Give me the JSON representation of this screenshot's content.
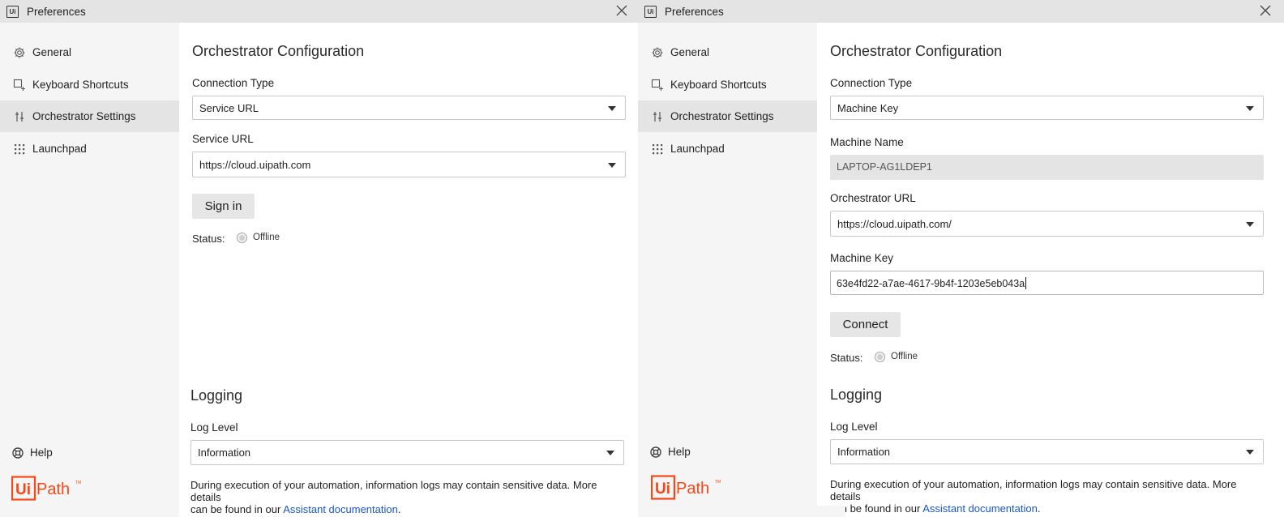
{
  "left": {
    "window_title": "Preferences",
    "sidebar": {
      "items": [
        {
          "label": "General",
          "icon": "gear-icon"
        },
        {
          "label": "Keyboard Shortcuts",
          "icon": "keyboard-shortcut-icon"
        },
        {
          "label": "Orchestrator Settings",
          "icon": "sliders-icon",
          "active": true
        },
        {
          "label": "Launchpad",
          "icon": "grid-dots-icon"
        }
      ],
      "help_label": "Help",
      "logo_text": "UiPath"
    },
    "orchestrator": {
      "heading": "Orchestrator Configuration",
      "connection_type_label": "Connection Type",
      "connection_type_value": "Service URL",
      "service_url_label": "Service URL",
      "service_url_value": "https://cloud.uipath.com",
      "signin_label": "Sign in",
      "status_label": "Status:",
      "status_value": "Offline"
    },
    "logging": {
      "heading": "Logging",
      "log_level_label": "Log Level",
      "log_level_value": "Information",
      "note_line1": "During execution of your automation, information logs may contain sensitive data. More details",
      "note_line2_prefix": "can be found in our ",
      "note_link": "Assistant documentation",
      "note_suffix": "."
    }
  },
  "right": {
    "window_title": "Preferences",
    "sidebar": {
      "items": [
        {
          "label": "General",
          "icon": "gear-icon"
        },
        {
          "label": "Keyboard Shortcuts",
          "icon": "keyboard-shortcut-icon"
        },
        {
          "label": "Orchestrator Settings",
          "icon": "sliders-icon",
          "active": true
        },
        {
          "label": "Launchpad",
          "icon": "grid-dots-icon"
        }
      ],
      "help_label": "Help",
      "logo_text": "UiPath"
    },
    "orchestrator": {
      "heading": "Orchestrator Configuration",
      "connection_type_label": "Connection Type",
      "connection_type_value": "Machine Key",
      "machine_name_label": "Machine Name",
      "machine_name_value": "LAPTOP-AG1LDEP1",
      "orchestrator_url_label": "Orchestrator URL",
      "orchestrator_url_value": "https://cloud.uipath.com/",
      "machine_key_label": "Machine Key",
      "machine_key_value": "63e4fd22-a7ae-4617-9b4f-1203e5eb043a",
      "connect_label": "Connect",
      "status_label": "Status:",
      "status_value": "Offline"
    },
    "logging": {
      "heading": "Logging",
      "log_level_label": "Log Level",
      "log_level_value": "Information",
      "note_line1": "During execution of your automation, information logs may contain sensitive data. More details",
      "note_line2_prefix": "can be found in our ",
      "note_link": "Assistant documentation",
      "note_suffix": "."
    }
  },
  "colors": {
    "brand_orange": "#fa4616",
    "link_blue": "#1a56c8",
    "sidebar_bg": "#f5f5f5",
    "active_bg": "#e4e4e4"
  }
}
